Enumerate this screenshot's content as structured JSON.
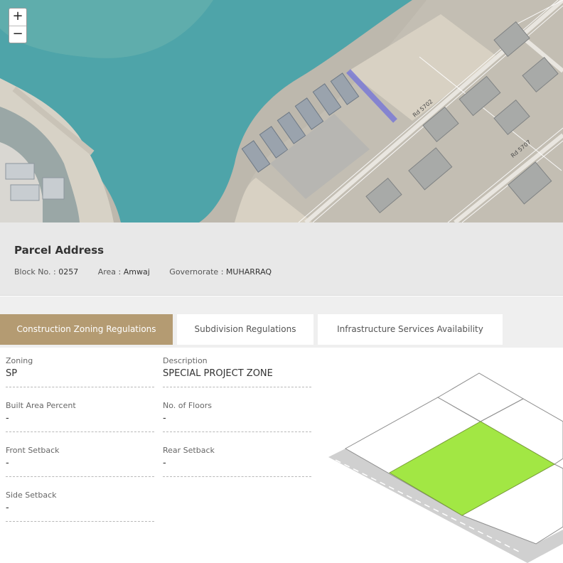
{
  "map": {
    "zoom_in_label": "+",
    "zoom_out_label": "−",
    "road_labels": [
      "Rd 5702",
      "Rd 5707"
    ]
  },
  "parcel_address": {
    "title": "Parcel Address",
    "block_label": "Block No. :",
    "block_value": "0257",
    "area_label": "Area :",
    "area_value": "Amwaj",
    "governorate_label": "Governorate :",
    "governorate_value": "MUHARRAQ"
  },
  "tabs": [
    {
      "label": "Construction Zoning Regulations",
      "active": true
    },
    {
      "label": "Subdivision Regulations",
      "active": false
    },
    {
      "label": "Infrastructure Services Availability",
      "active": false
    }
  ],
  "zoning": {
    "zoning": {
      "label": "Zoning",
      "value": "SP"
    },
    "description": {
      "label": "Description",
      "value": "SPECIAL PROJECT ZONE"
    },
    "built_area_percent": {
      "label": "Built Area Percent",
      "value": "-"
    },
    "no_of_floors": {
      "label": "No. of Floors",
      "value": "-"
    },
    "front_setback": {
      "label": "Front Setback",
      "value": "-"
    },
    "rear_setback": {
      "label": "Rear Setback",
      "value": "-"
    },
    "side_setback": {
      "label": "Side Setback",
      "value": "-"
    }
  },
  "colors": {
    "tab_active": "#b49b72",
    "parcel_highlight": "#a2e744",
    "map_selection": "#7b7bd6",
    "sea": "#4ea4a9"
  }
}
